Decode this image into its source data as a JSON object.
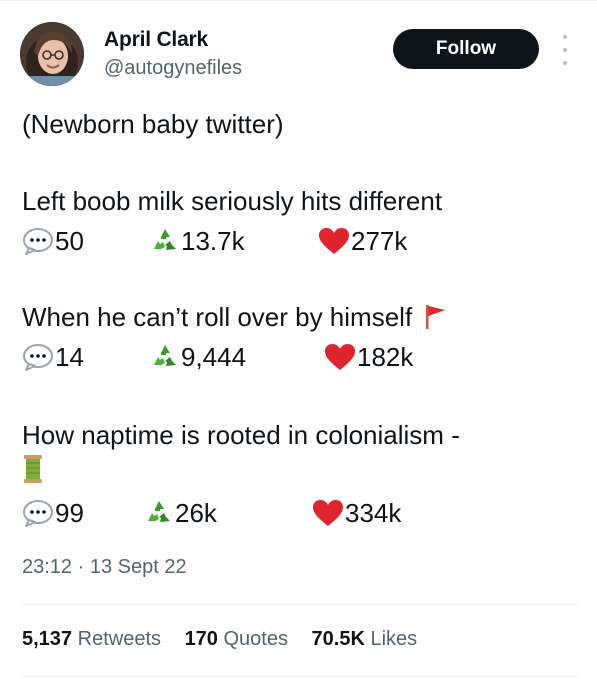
{
  "author": {
    "name": "April Clark",
    "handle": "@autogynefiles",
    "follow_label": "Follow"
  },
  "tweet": {
    "intro": "(Newborn baby twitter)",
    "posts": [
      {
        "text": "Left boob milk seriously hits different",
        "emoji": "",
        "replies": "50",
        "retweets": "13.7k",
        "likes": "277k"
      },
      {
        "text": "When he can’t roll over by himself",
        "emoji": "red-flag-icon",
        "replies": "14",
        "retweets": "9,444",
        "likes": "182k"
      },
      {
        "text": "How naptime is rooted in colonialism -",
        "emoji": "thread-spool-icon",
        "replies": "99",
        "retweets": "26k",
        "likes": "334k"
      }
    ],
    "timestamp": "23:12 · 13 Sept 22"
  },
  "engagement": {
    "retweets_count": "5,137",
    "retweets_label": "Retweets",
    "quotes_count": "170",
    "quotes_label": "Quotes",
    "likes_count": "70.5K",
    "likes_label": "Likes"
  },
  "colors": {
    "text": "#0f1419",
    "secondary": "#536471",
    "follow_bg": "#0f1419",
    "heart": "#e0242e",
    "recycle": "#3a9c2f"
  }
}
